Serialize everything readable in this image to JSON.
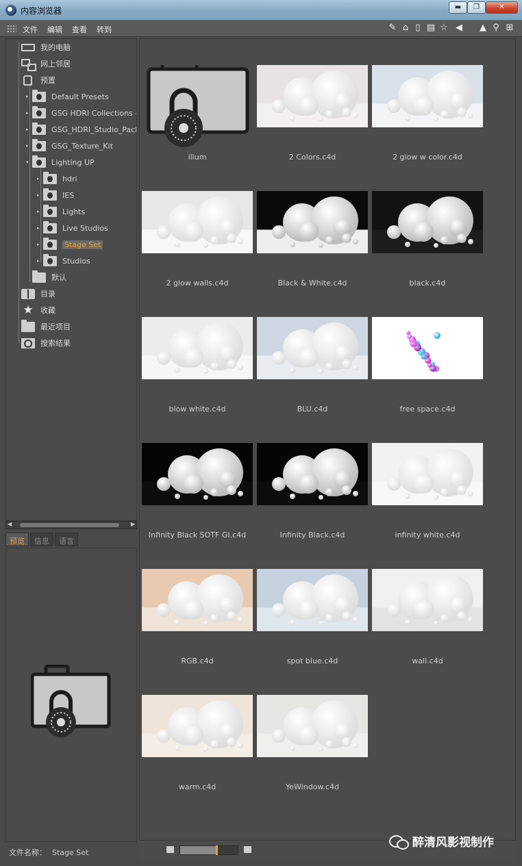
{
  "window": {
    "title": "内容浏览器",
    "minimize": "▬",
    "maximize": "❐",
    "close": "✕"
  },
  "menu": [
    "文件",
    "编辑",
    "查看",
    "转到"
  ],
  "toolbar_icons": [
    "edit-icon",
    "home-icon",
    "jar-icon",
    "book-icon",
    "star-icon",
    "back-icon",
    "forward-icon",
    "search-icon",
    "new-icon"
  ],
  "toolbar_glyphs": {
    "edit": "✎",
    "home": "⌂",
    "jar": "▯",
    "book": "▤",
    "star": "☆",
    "back": "◀",
    "forward": "▲",
    "search": "⚲",
    "new": "⊞"
  },
  "tree": [
    {
      "label": "我的电脑",
      "icon": "computer-icon"
    },
    {
      "label": "网上邻居",
      "icon": "network-icon"
    },
    {
      "label": "预置",
      "icon": "presets-icon"
    },
    {
      "label": "Default Presets",
      "icon": "lock-folder-icon"
    },
    {
      "label": "GSG HDRI Collections -",
      "icon": "lock-folder-icon"
    },
    {
      "label": "GSG_HDRI_Studio_Pack",
      "icon": "lock-folder-icon"
    },
    {
      "label": "GSG_Texture_Kit",
      "icon": "lock-folder-icon"
    },
    {
      "label": "Lighting UP",
      "icon": "lock-folder-open-icon"
    },
    {
      "label": "hdri",
      "icon": "lock-folder-icon"
    },
    {
      "label": "IES",
      "icon": "lock-folder-icon"
    },
    {
      "label": "Lights",
      "icon": "lock-folder-icon"
    },
    {
      "label": "Live Studios",
      "icon": "lock-folder-icon"
    },
    {
      "label": "Stage Set",
      "icon": "lock-folder-icon",
      "selected": true
    },
    {
      "label": "Studios",
      "icon": "lock-folder-icon"
    },
    {
      "label": "默认",
      "icon": "folder-icon"
    },
    {
      "label": "目录",
      "icon": "catalog-icon"
    },
    {
      "label": "收藏",
      "icon": "star-icon"
    },
    {
      "label": "最近项目",
      "icon": "folder-icon"
    },
    {
      "label": "搜索结果",
      "icon": "search-icon"
    }
  ],
  "preview_tabs": [
    "预览",
    "信息",
    "语言"
  ],
  "file_name": {
    "label": "文件名称：",
    "value": "Stage Set"
  },
  "items": [
    {
      "name": "illum",
      "kind": "lock"
    },
    {
      "name": "2 Colors.c4d",
      "bg": "#e8e2e6",
      "floor": "#f3eff2"
    },
    {
      "name": "2 glow w color.c4d",
      "bg": "#d9e1ea",
      "floor": "#f2f4f6"
    },
    {
      "name": "2 glow walls.c4d",
      "bg": "#e7e7e7",
      "floor": "#f7f7f7"
    },
    {
      "name": "Black & White.c4d",
      "bg": "#0a0a0a",
      "floor": "#eeeeee"
    },
    {
      "name": "black.c4d",
      "bg": "#121212",
      "floor": "#1c1c1c"
    },
    {
      "name": "blow white.c4d",
      "bg": "#ececec",
      "floor": "#f6f6f6"
    },
    {
      "name": "BLU.c4d",
      "bg": "#cfd8e2",
      "floor": "#e8ecf0"
    },
    {
      "name": "free space.c4d",
      "bg": "#ffffff",
      "floor": "#ffffff",
      "special": "magenta"
    },
    {
      "name": "Infinity  Black SOTF GI.c4d",
      "bg": "#050505",
      "floor": "#0c0c0c"
    },
    {
      "name": "Infinity  Black.c4d",
      "bg": "#050505",
      "floor": "#0c0c0c"
    },
    {
      "name": "infinity white.c4d",
      "bg": "#f2f2f2",
      "floor": "#f8f8f8"
    },
    {
      "name": "RGB.c4d",
      "bg": "#e9c9b0",
      "floor": "#f0e3d8"
    },
    {
      "name": "spot blue.c4d",
      "bg": "#c5d1dc",
      "floor": "#dfe6ec"
    },
    {
      "name": "wall.c4d",
      "bg": "#f0f0f0",
      "floor": "#e3e3e3"
    },
    {
      "name": "warm.c4d",
      "bg": "#efe4da",
      "floor": "#f4ede6"
    },
    {
      "name": "YeWindow.c4d",
      "bg": "#e6e6e3",
      "floor": "#efefed"
    }
  ],
  "watermark": "醉清风影视制作",
  "zoom": {
    "fraction": 0.63
  }
}
